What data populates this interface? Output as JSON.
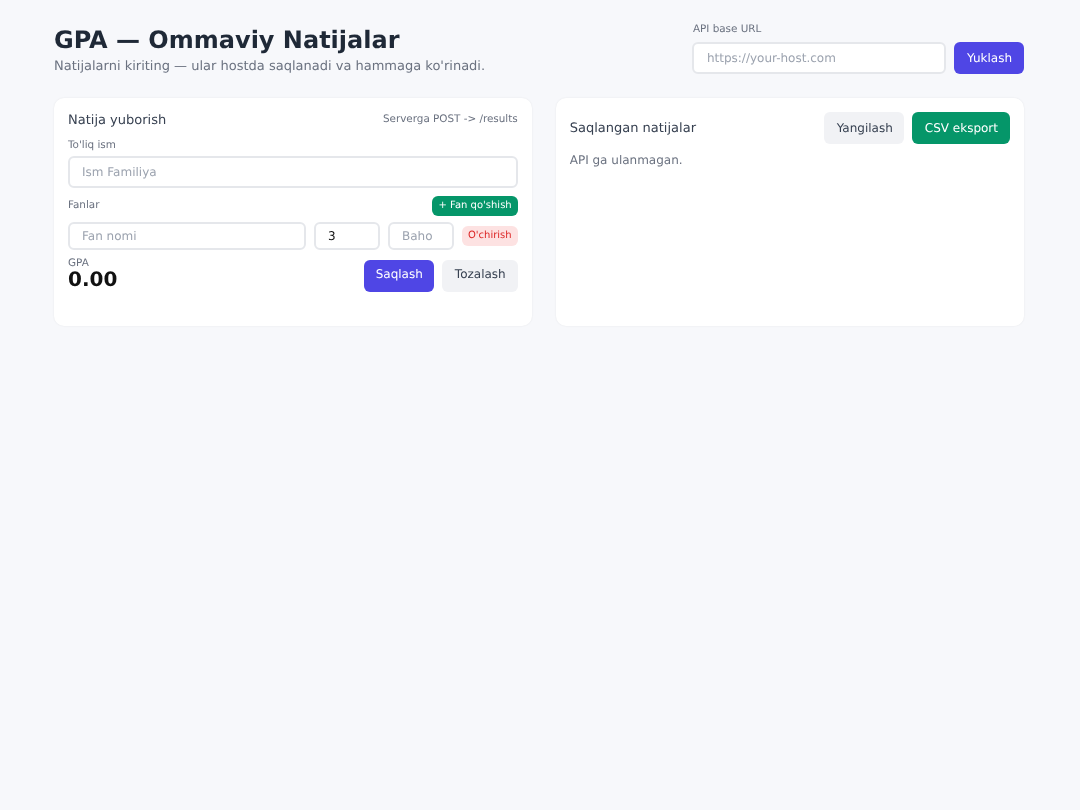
{
  "header": {
    "title": "GPA — Ommaviy Natijalar",
    "subtitle": "Natijalarni kiriting — ular hostda saqlanadi va hammaga ko'rinadi."
  },
  "api": {
    "label": "API base URL",
    "placeholder": "https://your-host.com",
    "button": "Yuklash"
  },
  "submit_card": {
    "title": "Natija yuborish",
    "hint": "Serverga POST -> /results",
    "name_label": "To'liq ism",
    "name_placeholder": "Ism Familiya",
    "subjects_label": "Fanlar",
    "add_button": "+ Fan qo'shish",
    "subjects": [
      {
        "name_placeholder": "Fan nomi",
        "credits": "3",
        "grade_placeholder": "Baho",
        "remove_button": "O'chirish"
      }
    ],
    "gpa_label": "GPA",
    "gpa_value": "0.00",
    "save_button": "Saqlash",
    "clear_button": "Tozalash"
  },
  "results_card": {
    "title": "Saqlangan natijalar",
    "refresh_button": "Yangilash",
    "export_button": "CSV eksport",
    "status": "API ga ulanmagan."
  }
}
